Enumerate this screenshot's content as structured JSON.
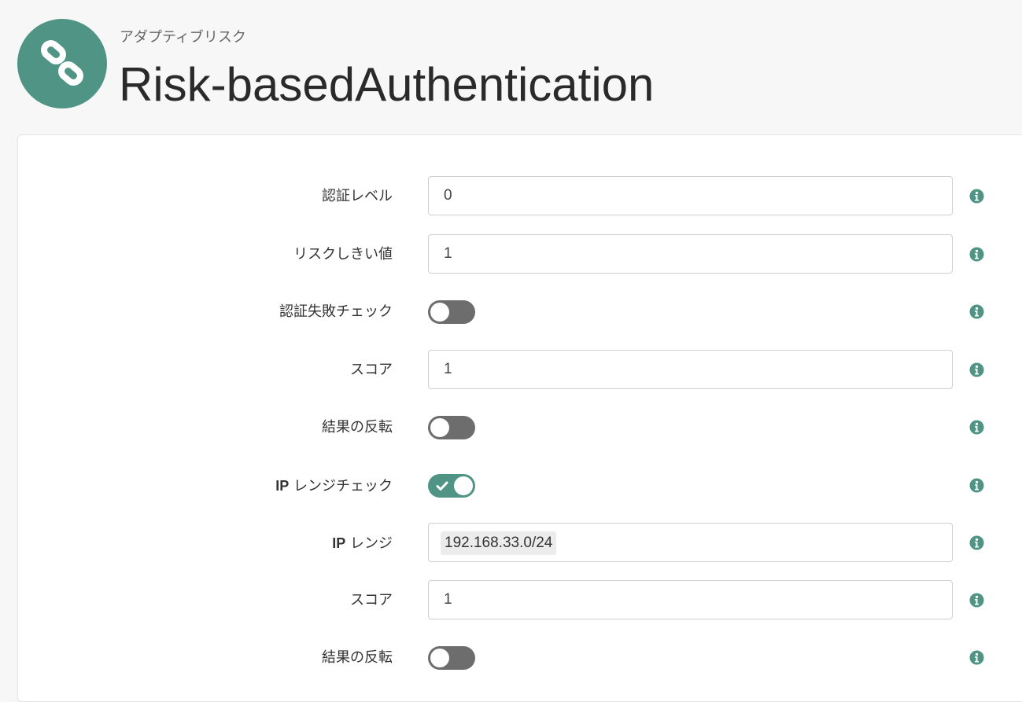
{
  "header": {
    "subtitle": "アダプティブリスク",
    "title": "Risk-basedAuthentication",
    "logo_icon": "link-icon",
    "accent_color": "#4f9485"
  },
  "form": {
    "auth_level": {
      "label": "認証レベル",
      "value": "0"
    },
    "risk_threshold": {
      "label": "リスクしきい値",
      "value": "1"
    },
    "auth_failure_check": {
      "label": "認証失敗チェック",
      "enabled": false
    },
    "score_1": {
      "label": "スコア",
      "value": "1"
    },
    "invert_result_1": {
      "label": "結果の反転",
      "enabled": false
    },
    "ip_range_check": {
      "label_prefix": "IP",
      "label_suffix": " レンジチェック",
      "enabled": true
    },
    "ip_range": {
      "label_prefix": "IP",
      "label_suffix": " レンジ",
      "tag": "192.168.33.0/24"
    },
    "score_2": {
      "label": "スコア",
      "value": "1"
    },
    "invert_result_2": {
      "label": "結果の反転",
      "enabled": false
    }
  }
}
